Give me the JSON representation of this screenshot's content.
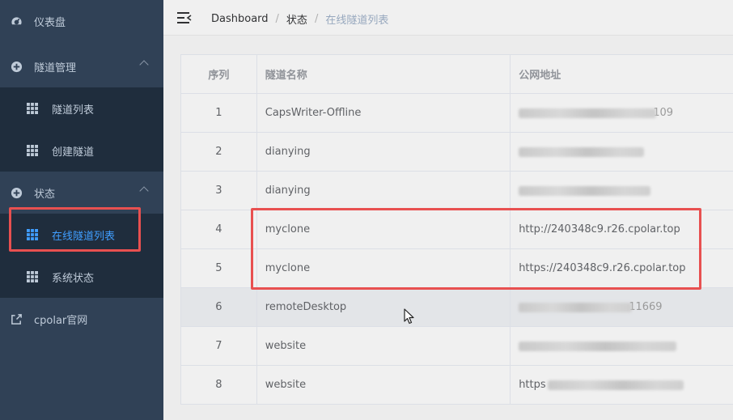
{
  "sidebar": {
    "items": [
      {
        "label": "仪表盘"
      },
      {
        "label": "隧道管理"
      },
      {
        "label": "隧道列表"
      },
      {
        "label": "创建隧道"
      },
      {
        "label": "状态"
      },
      {
        "label": "在线隧道列表"
      },
      {
        "label": "系统状态"
      },
      {
        "label": "cpolar官网"
      }
    ]
  },
  "breadcrumb": {
    "home": "Dashboard",
    "sep": "/",
    "section": "状态",
    "current": "在线隧道列表"
  },
  "table": {
    "headers": [
      "序列",
      "隧道名称",
      "公网地址"
    ],
    "rows": [
      {
        "idx": "1",
        "name": "CapsWriter-Offline",
        "url_suffix": "109"
      },
      {
        "idx": "2",
        "name": "dianying"
      },
      {
        "idx": "3",
        "name": "dianying"
      },
      {
        "idx": "4",
        "name": "myclone",
        "url": "http://240348c9.r26.cpolar.top"
      },
      {
        "idx": "5",
        "name": "myclone",
        "url": "https://240348c9.r26.cpolar.top"
      },
      {
        "idx": "6",
        "name": "remoteDesktop",
        "url_suffix": "11669"
      },
      {
        "idx": "7",
        "name": "website"
      },
      {
        "idx": "8",
        "name": "website",
        "url_prefix": "https"
      }
    ]
  },
  "colors": {
    "sidebar_bg": "#304156",
    "submenu_bg": "#1f2d3d",
    "active": "#409eff",
    "highlight": "#e85050"
  }
}
